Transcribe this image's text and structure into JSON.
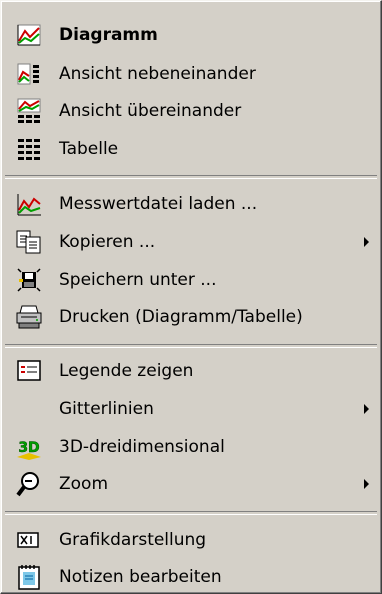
{
  "menu": {
    "items": [
      {
        "label": "Diagramm",
        "icon": "chart-icon",
        "bold": true
      },
      {
        "label": "Ansicht nebeneinander",
        "icon": "side-by-side-view-icon"
      },
      {
        "label": "Ansicht übereinander",
        "icon": "stacked-view-icon"
      },
      {
        "label": "Tabelle",
        "icon": "table-icon"
      },
      {
        "label": "Messwertdatei laden ...",
        "icon": "load-data-icon"
      },
      {
        "label": "Kopieren ...",
        "icon": "copy-icon",
        "submenu": true
      },
      {
        "label": "Speichern unter ...",
        "icon": "save-icon"
      },
      {
        "label": "Drucken (Diagramm/Tabelle)",
        "icon": "printer-icon"
      },
      {
        "label": "Legende zeigen",
        "icon": "legend-icon"
      },
      {
        "label": "Gitterlinien",
        "icon": "",
        "submenu": true
      },
      {
        "label": "3D-dreidimensional",
        "icon": "3d-icon"
      },
      {
        "label": "Zoom",
        "icon": "zoom-icon",
        "submenu": true
      },
      {
        "label": "Grafikdarstellung",
        "icon": "graphics-icon"
      },
      {
        "label": "Notizen bearbeiten",
        "icon": "notes-icon"
      }
    ],
    "icon_texts": {
      "three_d": "3D"
    },
    "colors": {
      "background": "#d4d0c8",
      "accent_red": "#cc0000",
      "accent_green": "#00a000"
    }
  }
}
